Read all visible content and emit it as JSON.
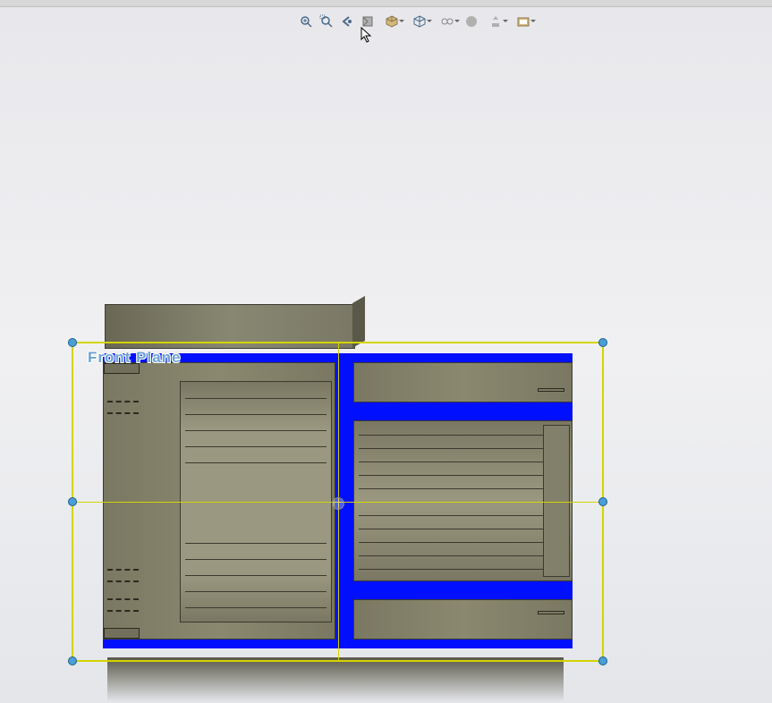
{
  "plane_label": "Front Plane",
  "toolbar": {
    "zoom_fit": "zoom-to-fit",
    "zoom_area": "zoom-to-area",
    "prev_view": "previous-view",
    "section_view": "section-view",
    "view_orientation": "view-orientation",
    "display_style": "display-style",
    "hide_show": "hide-show-items",
    "edit_appearance": "edit-appearance",
    "apply_scene": "apply-scene",
    "view_settings": "view-settings"
  },
  "annotation": {
    "arrow_color": "#ff0000"
  }
}
